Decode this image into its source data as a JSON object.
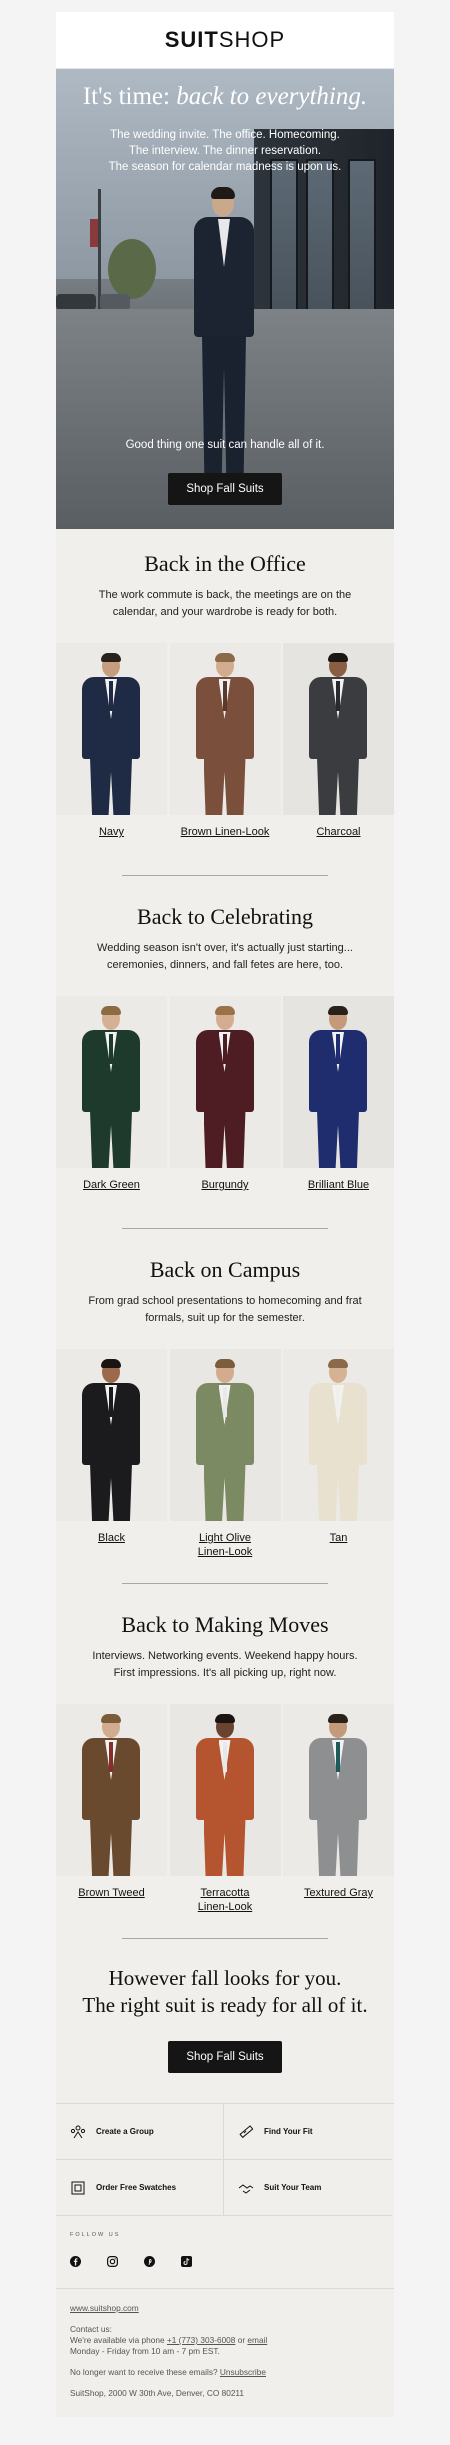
{
  "header": {
    "logo_bold": "SUIT",
    "logo_light": "SHOP"
  },
  "hero": {
    "title_plain": "It's time: ",
    "title_italic": "back to everything.",
    "sub_lines": [
      "The wedding invite. The office. Homecoming.",
      "The interview. The dinner reservation.",
      "The season for calendar madness is upon us."
    ],
    "foot": "Good thing one suit can handle all of it.",
    "button": "Shop Fall Suits"
  },
  "sections": [
    {
      "title": "Back in the Office",
      "body": "The work commute is back, the meetings are on the calendar, and your wardrobe is ready for both.",
      "products": [
        {
          "label": "Navy",
          "jacket": "#1f2a44",
          "skin": "#c79d7f",
          "hair": "#2a211b",
          "bg": "#eceae6",
          "tie": "#1f2a44"
        },
        {
          "label": "Brown Linen-Look",
          "jacket": "#7a4f3c",
          "skin": "#d3ab8f",
          "hair": "#8b6a4a",
          "bg": "#eceae6",
          "tie": "#5a3a2b"
        },
        {
          "label": "Charcoal",
          "jacket": "#3a3c40",
          "skin": "#8a5e43",
          "hair": "#1d1714",
          "bg": "#e6e4e0",
          "tie": "#2a2a2d"
        }
      ]
    },
    {
      "title": "Back to Celebrating",
      "body": "Wedding season isn't over, it's actually just starting... ceremonies, dinners, and fall fetes are here, too.",
      "products": [
        {
          "label": "Dark Green",
          "jacket": "#1e3a2c",
          "skin": "#d6b093",
          "hair": "#8c6a42",
          "bg": "#eceae6",
          "tie": "#1e3a2c"
        },
        {
          "label": "Burgundy",
          "jacket": "#4e1d24",
          "skin": "#d4ad90",
          "hair": "#9a7148",
          "bg": "#eceae6",
          "tie": "#4e1d24"
        },
        {
          "label": "Brilliant Blue",
          "jacket": "#1f2d6e",
          "skin": "#c49a7b",
          "hair": "#2a211b",
          "bg": "#e6e4e0",
          "tie": "#1f2d6e"
        }
      ]
    },
    {
      "title": "Back on Campus",
      "body": "From grad school presentations to homecoming and frat formals, suit up for the semester.",
      "products": [
        {
          "label": "Black",
          "jacket": "#1b1b1d",
          "skin": "#9a6a4b",
          "hair": "#1a1512",
          "bg": "#eceae6",
          "tie": "#1b1b1d"
        },
        {
          "label": "Light Olive Linen-Look",
          "jacket": "#7c8a63",
          "skin": "#d3ab8e",
          "hair": "#7d5c3b",
          "bg": "#e9e7e3",
          "tie": "#e8e8e8"
        },
        {
          "label": "Tan",
          "jacket": "#e8e1cf",
          "skin": "#d6b194",
          "hair": "#8a6a48",
          "bg": "#eceae6",
          "tie": "#f2f0ea"
        }
      ]
    },
    {
      "title": "Back to Making Moves",
      "body": "Interviews. Networking events. Weekend happy hours. First impressions. It's all picking up, right now.",
      "products": [
        {
          "label": "Brown Tweed",
          "jacket": "#6a4a2f",
          "skin": "#d3ab8e",
          "hair": "#7d5c3b",
          "bg": "#eceae6",
          "tie": "#8a2c2c"
        },
        {
          "label": "Terracotta Linen-Look",
          "jacket": "#b4552f",
          "skin": "#6b4431",
          "hair": "#1a1512",
          "bg": "#e9e7e3",
          "tie": "#e8e8e8"
        },
        {
          "label": "Textured Gray",
          "jacket": "#8e8f91",
          "skin": "#c49a7b",
          "hair": "#2a211b",
          "bg": "#eceae6",
          "tie": "#1d5a5a"
        }
      ]
    }
  ],
  "closing": {
    "line1": "However fall looks for you.",
    "line2": "The right suit is ready for all of it.",
    "button": "Shop Fall Suits"
  },
  "links": [
    {
      "label": "Create a Group",
      "icon": "group-icon"
    },
    {
      "label": "Find Your Fit",
      "icon": "measuring-tape-icon"
    },
    {
      "label": "Order Free Swatches",
      "icon": "swatch-icon"
    },
    {
      "label": "Suit Your Team",
      "icon": "handshake-icon"
    }
  ],
  "follow": {
    "label": "FOLLOW US",
    "icons": [
      "facebook-icon",
      "instagram-icon",
      "pinterest-icon",
      "tiktok-icon"
    ]
  },
  "footer": {
    "site": "www.suitshop.com",
    "contact": "Contact us:",
    "phone_prefix": "We're available via phone ",
    "phone": "+1 (773) 303-6008",
    "or": " or ",
    "email": "email",
    "hours": "Monday - Friday from 10 am - 7 pm EST.",
    "unsub_text": "No longer want to receive these emails? ",
    "unsub": "Unsubscribe",
    "address": "SuitShop, 2000 W 30th Ave, Denver, CO 80211"
  },
  "colors": {
    "page_bg": "#f4f4f4",
    "panel_bg": "#f1efeb",
    "button_bg": "#151515"
  }
}
